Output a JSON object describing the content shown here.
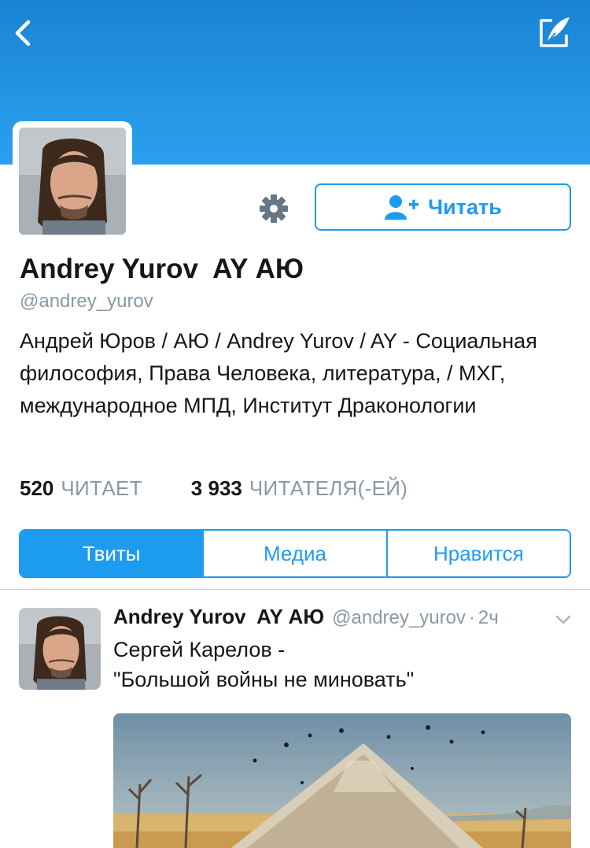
{
  "colors": {
    "accent": "#1d9bf0",
    "banner": "#2394e2",
    "muted": "#8899a6",
    "text": "#14171a"
  },
  "nav": {
    "back_icon": "chevron-left-icon",
    "compose_icon": "compose-quill-icon"
  },
  "profile": {
    "name": "Andrey Yurov  AY АЮ",
    "handle": "@andrey_yurov",
    "bio": "Андрей Юров / АЮ / Andrey Yurov / AY - Социальная философия, Права Человека, литература, / МХГ, международное МПД, Институт Драконологии",
    "follow_label": "Читать",
    "follow_icon": "add-user-icon",
    "settings_icon": "gear-icon"
  },
  "stats": {
    "following_count": "520",
    "following_label": "ЧИТАЕТ",
    "followers_count": "3 933",
    "followers_label": "ЧИТАТЕЛЯ(-ЕЙ)"
  },
  "tabs": [
    {
      "label": "Твиты",
      "active": true
    },
    {
      "label": "Медиа",
      "active": false
    },
    {
      "label": "Нравится",
      "active": false
    }
  ],
  "tweet": {
    "name": "Andrey Yurov  AY АЮ",
    "handle": "@andrey_yurov",
    "dot": "·",
    "time": "2ч",
    "text_line1": "Сергей Карелов -",
    "text_line2": "\"Большой войны не миновать\"",
    "caret_icon": "chevron-down-icon"
  }
}
